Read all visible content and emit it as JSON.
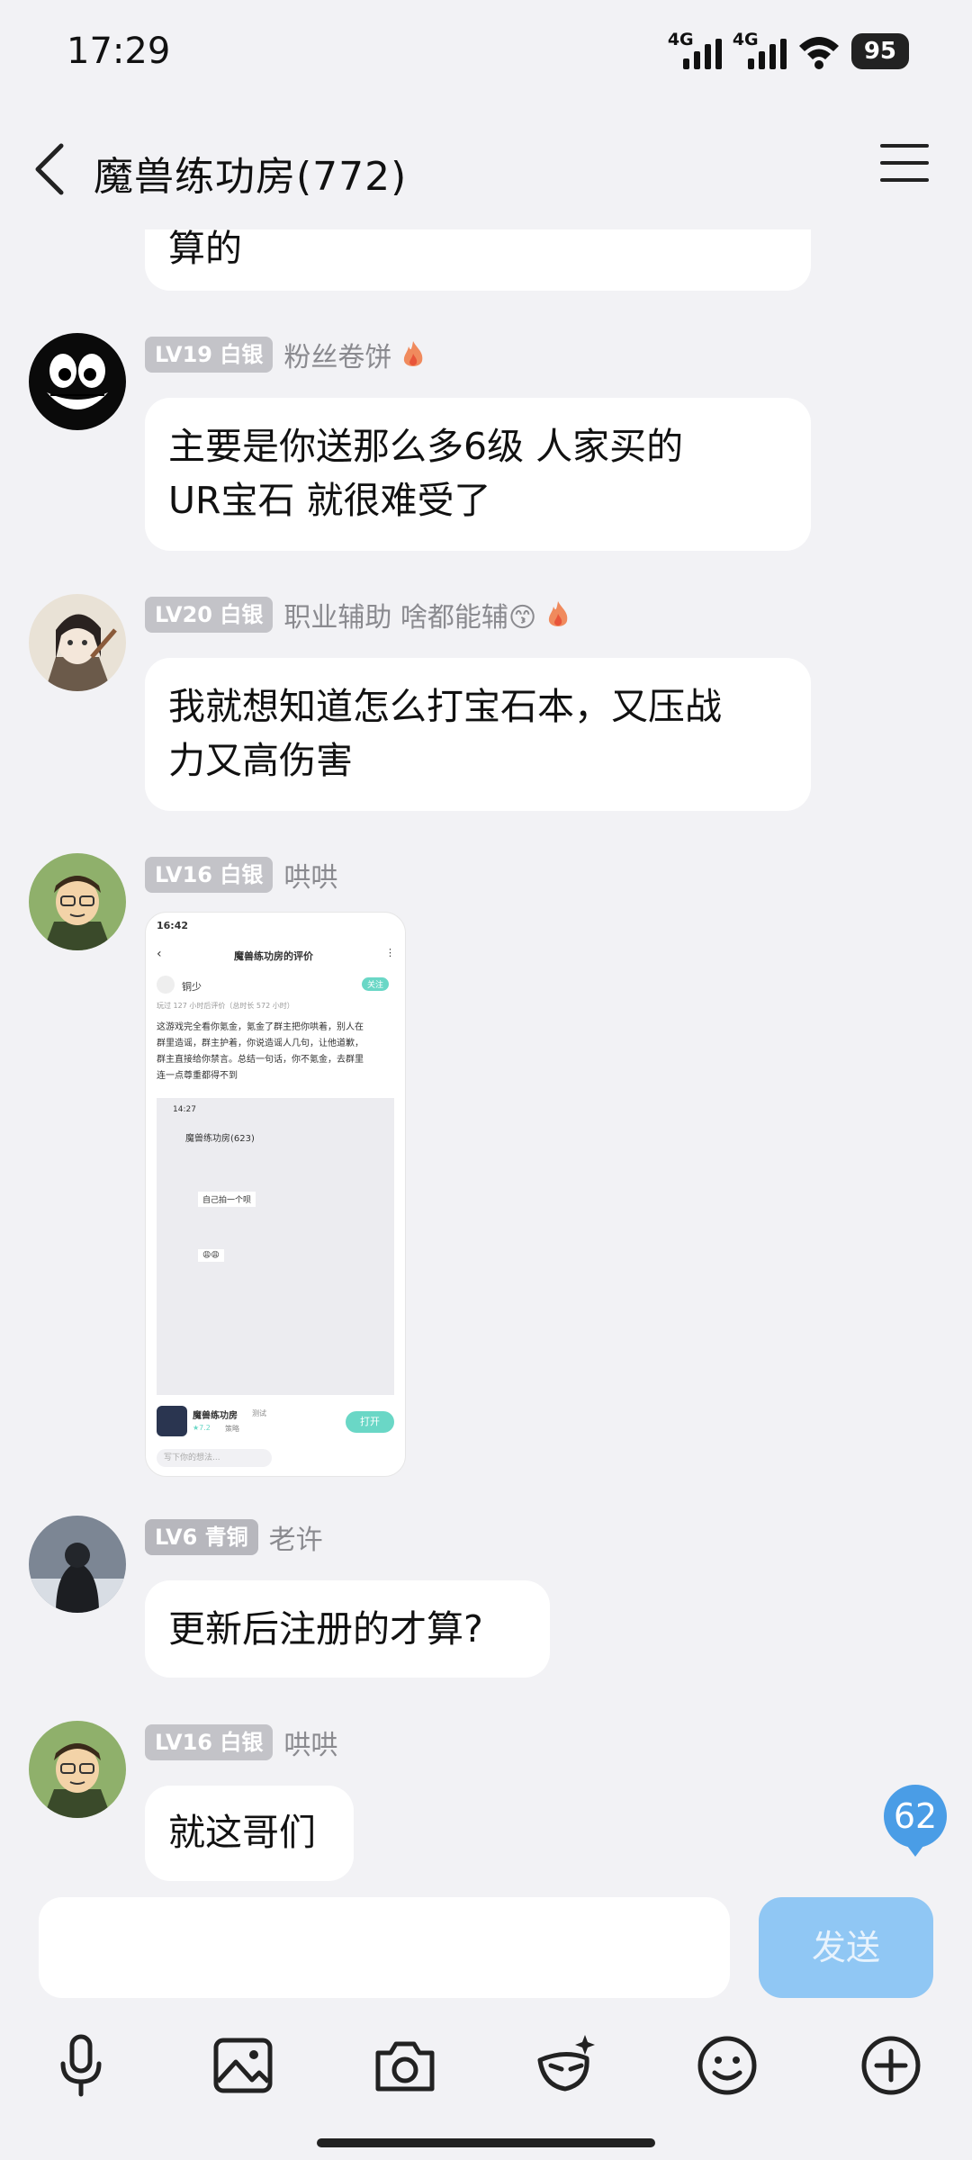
{
  "status_bar": {
    "time": "17:29",
    "network_1": "4G",
    "network_2": "4G",
    "battery": "95"
  },
  "header": {
    "title": "魔兽练功房(772)"
  },
  "messages": [
    {
      "text": "算的"
    },
    {
      "level": "LV19 白银",
      "nickname": "粉丝卷饼",
      "text_line1": "主要是你送那么多6级  人家买的",
      "text_line2": "UR宝石  就很难受了"
    },
    {
      "level": "LV20 白银",
      "nickname": "职业辅助 啥都能辅😙",
      "text_line1": "我就想知道怎么打宝石本，又压战",
      "text_line2": "力又高伤害"
    },
    {
      "level": "LV16 白银",
      "nickname": "哄哄",
      "image": {
        "time": "16:42",
        "title": "魔兽练功房的评价",
        "user": "铜少",
        "follow": "关注",
        "play_info": "玩过 127 小时后评价（总时长 572 小时）",
        "review_1": "这游戏完全看你氪金，氪金了群主把你哄着，别人在",
        "review_2": "群里造谣，群主护着，你说造谣人几句，让他道歉，",
        "review_3": "群主直接给你禁言。总结一句话，你不氪金，去群里",
        "review_4": "连一点尊重都得不到",
        "inner_time": "14:27",
        "inner_title": "魔兽练功房(623)",
        "inner_msg_1": "自己拍一个呗",
        "inner_msg_2": "😩😩",
        "game_name": "魔兽练功房",
        "game_tag": "测试",
        "game_rating": "★7.2",
        "game_sub": "策略",
        "open_label": "打开",
        "reply_placeholder": "写下你的想法..."
      }
    },
    {
      "level": "LV6 青铜",
      "nickname": "老许",
      "text": "更新后注册的才算?"
    },
    {
      "level": "LV16 白银",
      "nickname": "哄哄",
      "text": "就这哥们"
    }
  ],
  "unread_badge": "62",
  "input": {
    "placeholder": "",
    "send_label": "发送"
  },
  "toolbar": [
    "microphone-icon",
    "image-icon",
    "camera-icon",
    "ai-assistant-icon",
    "emoji-icon",
    "plus-icon"
  ]
}
